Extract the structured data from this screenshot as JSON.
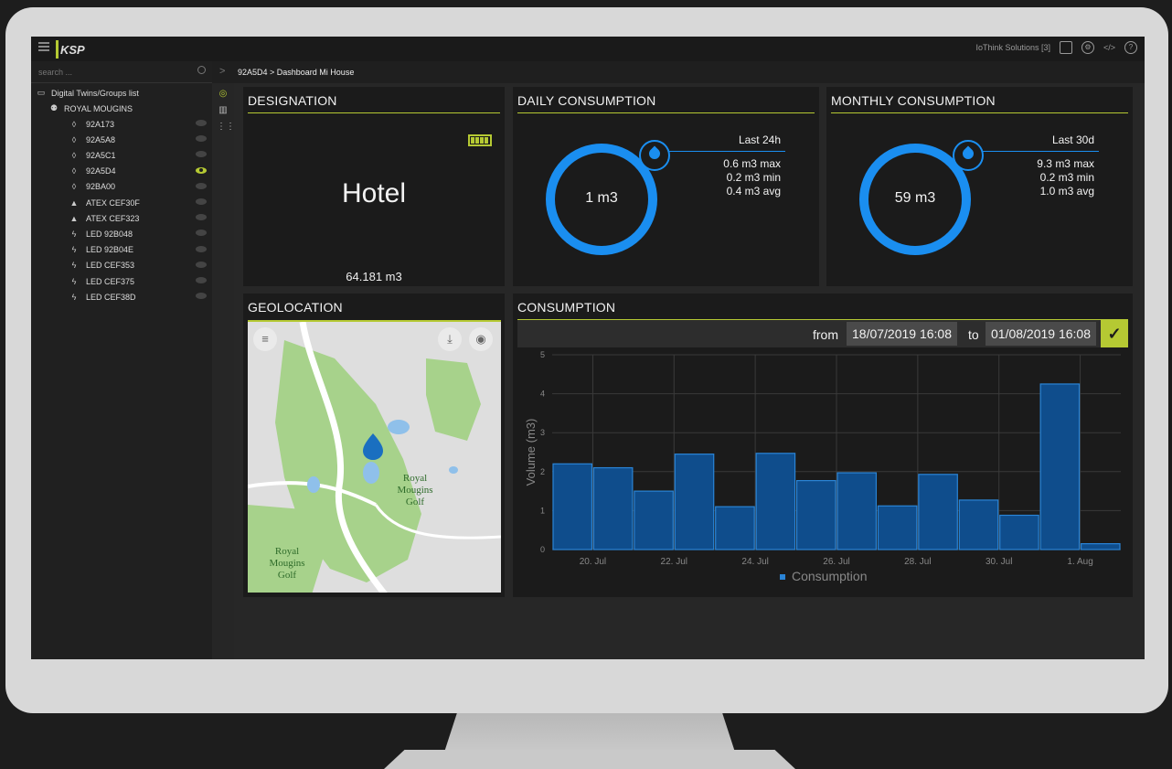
{
  "topbar": {
    "logo_text": "KSP",
    "org_label": "IoThink Solutions [3]"
  },
  "search": {
    "placeholder": "search ..."
  },
  "breadcrumb": "92A5D4 > Dashboard Mi House",
  "sidebar": {
    "root_label": "Digital Twins/Groups list",
    "group_label": "ROYAL MOUGINS",
    "items": [
      {
        "label": "92A173",
        "icon": "drop-icon",
        "selected": false
      },
      {
        "label": "92A5A8",
        "icon": "drop-icon",
        "selected": false
      },
      {
        "label": "92A5C1",
        "icon": "drop-icon",
        "selected": false
      },
      {
        "label": "92A5D4",
        "icon": "drop-icon",
        "selected": true
      },
      {
        "label": "92BA00",
        "icon": "drop-icon",
        "selected": false
      },
      {
        "label": "ATEX CEF30F",
        "icon": "flame-icon",
        "selected": false
      },
      {
        "label": "ATEX CEF323",
        "icon": "flame-icon",
        "selected": false
      },
      {
        "label": "LED 92B048",
        "icon": "bolt-icon",
        "selected": false
      },
      {
        "label": "LED 92B04E",
        "icon": "bolt-icon",
        "selected": false
      },
      {
        "label": "LED CEF353",
        "icon": "bolt-icon",
        "selected": false
      },
      {
        "label": "LED CEF375",
        "icon": "bolt-icon",
        "selected": false
      },
      {
        "label": "LED CEF38D",
        "icon": "bolt-icon",
        "selected": false
      }
    ]
  },
  "designation": {
    "title": "DESIGNATION",
    "name": "Hotel",
    "total": "64.181 m3"
  },
  "daily": {
    "title": "DAILY CONSUMPTION",
    "value": "1 m3",
    "period": "Last 24h",
    "max": "0.6 m3 max",
    "min": "0.2 m3 min",
    "avg": "0.4 m3 avg"
  },
  "monthly": {
    "title": "MONTHLY CONSUMPTION",
    "value": "59 m3",
    "period": "Last 30d",
    "max": "9.3 m3 max",
    "min": "0.2 m3 min",
    "avg": "1.0 m3 avg"
  },
  "geolocation": {
    "title": "GEOLOCATION",
    "map_labels": [
      "Royal Mougins Golf",
      "Royal Mougins Golf"
    ]
  },
  "consumption": {
    "title": "CONSUMPTION",
    "from_label": "from",
    "from_date": "18/07/2019 16:08",
    "to_label": "to",
    "to_date": "01/08/2019 16:08"
  },
  "colors": {
    "accent": "#b5c933",
    "ring": "#1a8ef0",
    "bar": "#0f4d8c",
    "bar_edge": "#2a84d6"
  },
  "chart_data": {
    "type": "bar",
    "categories": [
      "18 Jul",
      "19 Jul",
      "20 Jul",
      "21 Jul",
      "22 Jul",
      "23 Jul",
      "24 Jul",
      "25 Jul",
      "26 Jul",
      "27 Jul",
      "28 Jul",
      "29 Jul",
      "30 Jul",
      "31 Jul",
      "1 Aug"
    ],
    "series": [
      {
        "name": "Consumption",
        "values": [
          2.2,
          2.1,
          1.5,
          2.45,
          1.1,
          2.47,
          1.77,
          1.97,
          1.12,
          1.93,
          1.27,
          0.88,
          4.25,
          0.15
        ]
      }
    ],
    "x_ticks": [
      "20. Jul",
      "22. Jul",
      "24. Jul",
      "26. Jul",
      "28. Jul",
      "30. Jul",
      "1. Aug"
    ],
    "ylabel": "Volume (m3)",
    "ylim": [
      0,
      5
    ],
    "y_ticks": [
      0,
      1,
      2,
      3,
      4,
      5
    ],
    "legend": "bottom",
    "grid": true
  }
}
